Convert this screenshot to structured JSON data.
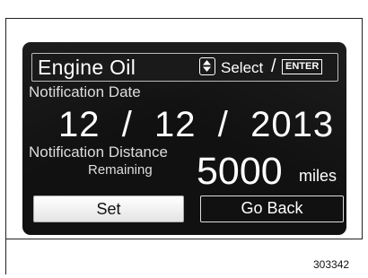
{
  "screen": {
    "title": "Engine Oil",
    "header": {
      "select_label": "Select",
      "separator": "/",
      "enter_label": "ENTER",
      "icon": "up-down-arrow-icon"
    },
    "notification_date": {
      "label": "Notification Date",
      "value": "12  /  12  /  2013"
    },
    "notification_distance": {
      "label": "Notification Distance",
      "sublabel": "Remaining",
      "value": "5000",
      "unit": "miles"
    },
    "buttons": {
      "set_label": "Set",
      "go_back_label": "Go Back"
    }
  },
  "figure_id": "303342",
  "colors": {
    "screen_background": "#111111",
    "text": "#ffffff",
    "set_button": "#f2f2f2"
  }
}
